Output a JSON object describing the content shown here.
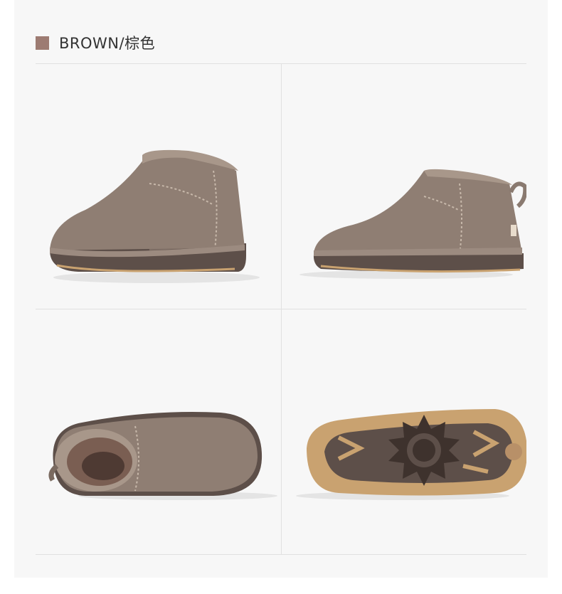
{
  "header": {
    "color_label": "BROWN/棕色",
    "swatch_color": "#9d7b72"
  },
  "gallery": [
    {
      "view": "front-three-quarter",
      "icon": "boot-front-icon"
    },
    {
      "view": "side",
      "icon": "boot-side-icon"
    },
    {
      "view": "top-interior",
      "icon": "boot-top-icon"
    },
    {
      "view": "sole",
      "icon": "boot-sole-icon"
    }
  ],
  "colors": {
    "suede": "#8f7e73",
    "suede_light": "#a8978a",
    "sole_dark": "#5d4f49",
    "outsole_tan": "#c9a270",
    "sheepskin": "#7a5e52"
  }
}
